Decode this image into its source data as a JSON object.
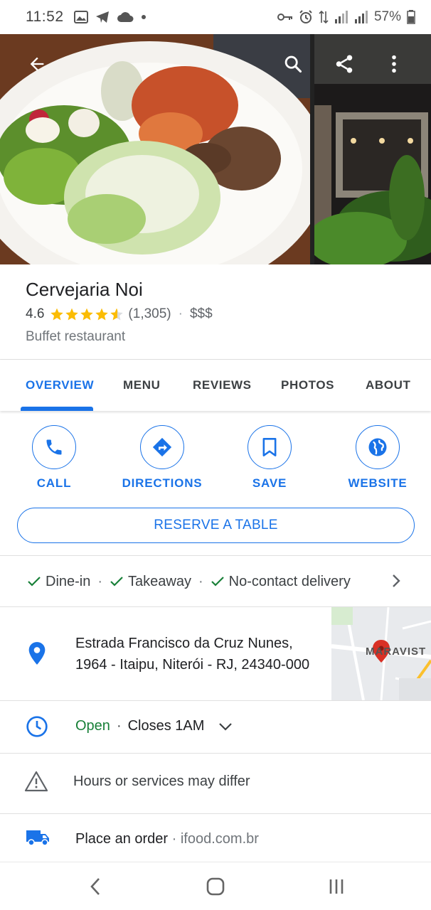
{
  "status_bar": {
    "time": "11:52",
    "battery": "57%"
  },
  "place": {
    "name": "Cervejaria Noi",
    "rating": "4.6",
    "rating_value": 4.6,
    "review_count": "(1,305)",
    "price": "$$$",
    "category": "Buffet restaurant"
  },
  "tabs": [
    {
      "label": "OVERVIEW",
      "active": true
    },
    {
      "label": "MENU",
      "active": false
    },
    {
      "label": "REVIEWS",
      "active": false
    },
    {
      "label": "PHOTOS",
      "active": false
    },
    {
      "label": "ABOUT",
      "active": false
    }
  ],
  "actions": {
    "call": "CALL",
    "directions": "DIRECTIONS",
    "save": "SAVE",
    "website": "WEBSITE"
  },
  "reserve_label": "RESERVE A TABLE",
  "services": [
    {
      "label": "Dine-in"
    },
    {
      "label": "Takeaway"
    },
    {
      "label": "No-contact delivery"
    }
  ],
  "address": {
    "line1": "Estrada Francisco da Cruz Nunes,",
    "line2": "1964 - Itaipu, Niterói - RJ, 24340-000",
    "map_label": "MARAVIST"
  },
  "hours": {
    "status": "Open",
    "closes": "Closes 1AM"
  },
  "notice": "Hours or services may differ",
  "order": {
    "label": "Place an order",
    "domain": "ifood.com.br"
  },
  "colors": {
    "accent": "#1a73e8",
    "open_green": "#188038",
    "star": "#fbbc04"
  }
}
